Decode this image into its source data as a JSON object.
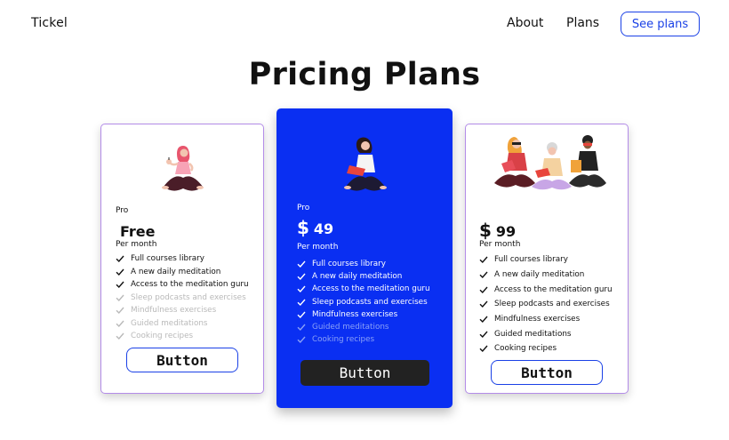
{
  "nav": {
    "brand": "Tickel",
    "about": "About",
    "plans": "Plans",
    "see_plans": "See plans"
  },
  "page_title": "Pricing Plans",
  "plans": [
    {
      "tier": "Pro",
      "currency": "",
      "price": "Free",
      "period": "Per month",
      "features": [
        {
          "label": "Full courses library",
          "included": true
        },
        {
          "label": "A new daily meditation",
          "included": true
        },
        {
          "label": "Access to the meditation guru",
          "included": true
        },
        {
          "label": "Sleep podcasts and exercises",
          "included": false
        },
        {
          "label": "Mindfulness exercises",
          "included": false
        },
        {
          "label": "Guided meditations",
          "included": false
        },
        {
          "label": "Cooking recipes",
          "included": false
        }
      ],
      "button": "Button"
    },
    {
      "tier": "Pro",
      "currency": "$",
      "price": "49",
      "period": "Per month",
      "features": [
        {
          "label": "Full courses library",
          "included": true
        },
        {
          "label": "A new daily meditation",
          "included": true
        },
        {
          "label": "Access to the meditation guru",
          "included": true
        },
        {
          "label": "Sleep podcasts and exercises",
          "included": true
        },
        {
          "label": "Mindfulness exercises",
          "included": true
        },
        {
          "label": "Guided meditations",
          "included": false
        },
        {
          "label": "Cooking recipes",
          "included": false
        }
      ],
      "button": "Button"
    },
    {
      "tier": "",
      "currency": "$",
      "price": "99",
      "period": "Per month",
      "features": [
        {
          "label": "Full courses library",
          "included": true
        },
        {
          "label": "A new daily meditation",
          "included": true
        },
        {
          "label": "Access to the meditation guru",
          "included": true
        },
        {
          "label": "Sleep podcasts and exercises",
          "included": true
        },
        {
          "label": "Mindfulness exercises",
          "included": true
        },
        {
          "label": "Guided meditations",
          "included": true
        },
        {
          "label": "Cooking recipes",
          "included": true
        }
      ],
      "button": "Button"
    }
  ],
  "colors": {
    "accent": "#1a41e6",
    "featured_card": "#0a2ff2",
    "card_border": "#b38ce8",
    "dark_button": "#222222"
  }
}
